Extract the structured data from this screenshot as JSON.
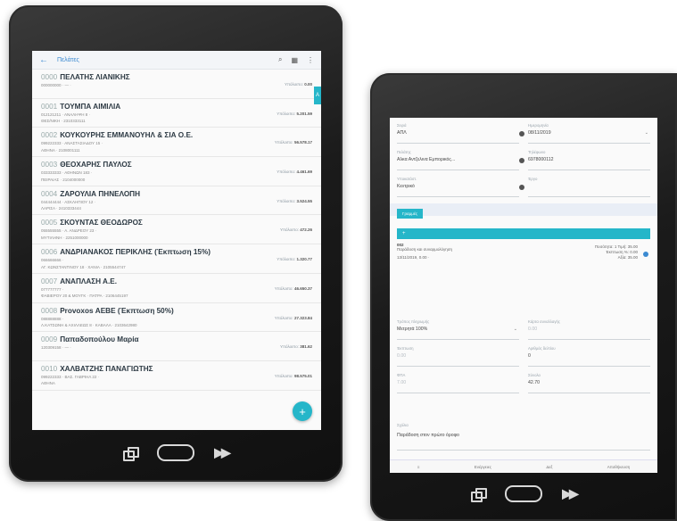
{
  "list_screen": {
    "title": "Πελάτες",
    "side_tab": "A",
    "fab": "+",
    "rows": [
      {
        "code": "0000",
        "name": "ΠΕΛΑΤΗΣ ΛΙΑΝΙΚΗΣ",
        "sub1": "000000000  ·  —  ·",
        "sub2": "",
        "bal_label": "Υπόλοιπο:",
        "bal": "0.00"
      },
      {
        "code": "0001",
        "name": "ΤΟΥΜΠΑ ΑΙΜΙΛΙΑ",
        "sub1": "012121211  ·  ΑΝΑΛΗΨΗ 8  ·",
        "sub2": "ΘΕΣ/ΝΙΚΗ  ·  2310333111",
        "bal_label": "Υπόλοιπο:",
        "bal": "5.201.59"
      },
      {
        "code": "0002",
        "name": "ΚΟΥΚΟΥΡΗΣ ΕΜΜΑΝΟΥΗΛ & ΣΙΑ Ο.Ε.",
        "sub1": "099222333  ·  ΑΝΑΣΤΑΣΙΑΔΟΥ 15  ·",
        "sub2": "ΑΘΗΝΑ  ·  2108001111",
        "bal_label": "Υπόλοιπο:",
        "bal": "56.578.17"
      },
      {
        "code": "0003",
        "name": "ΘΕΟΧΑΡΗΣ ΠΑΥΛΟΣ",
        "sub1": "033333333  ·  ΑΘΗΝΩΝ 183  ·",
        "sub2": "ΠΕΙΡΑΙΑΣ  ·  2104000000",
        "bal_label": "Υπόλοιπο:",
        "bal": "4.461.69"
      },
      {
        "code": "0004",
        "name": "ΖΑΡΟΥΛΙΑ ΠΗΝΕΛΟΠΗ",
        "sub1": "044444444  ·  ΑΣΚΛΗΠΙΟΥ 12  ·",
        "sub2": "ΛΑΡΙΣΑ  ·  2410333444",
        "bal_label": "Υπόλοιπο:",
        "bal": "3.524.55"
      },
      {
        "code": "0005",
        "name": "ΣΚΟΥΝΤΑΣ ΘΕΟΔΩΡΟΣ",
        "sub1": "055555555  ·  Α. ΑΝΔΡΕΟΥ 23  ·",
        "sub2": "ΜΥΤΙΛΗΝΗ  ·  2251000000",
        "bal_label": "Υπόλοιπο:",
        "bal": "472.26"
      },
      {
        "code": "0006",
        "name": "ΑΝΔΡΙΑΝΑΚΟΣ ΠΕΡΙΚΛΗΣ (Έκπτωση 15%)",
        "sub1": "066666666  ·",
        "sub2": "ΑΓ. ΚΩΝΣΤΑΝΤΙΝΟΥ 18  ·  ΧΑΝΙΑ  ·  2105544747",
        "bal_label": "Υπόλοιπο:",
        "bal": "1.320.77"
      },
      {
        "code": "0007",
        "name": "ΑΝΑΠΛΑΣΗ Α.Ε.",
        "sub1": "077777777  ·",
        "sub2": "ΦΑΒΙΕΡΟΥ 20 & ΜΟΥΓΚ  ·  ΠΑΤΡΑ  ·  2106445197",
        "bal_label": "Υπόλοιπο:",
        "bal": "46.650.37"
      },
      {
        "code": "0008",
        "name": "Provoxos ΑΕΒΕ (Έκπτωση 50%)",
        "sub1": "088888888  ·",
        "sub2": "Λ.ΚΑΤΣΩΝΗ & ΑΧΙΛΛΕΩΣ 8  ·  ΚΑΒΑΛΑ  ·  2103642980",
        "bal_label": "Υπόλοιπο:",
        "bal": "27.323.84"
      },
      {
        "code": "0009",
        "name": "Παπαδοπούλου Μαρία",
        "sub1": "120309158  ·  —  ·",
        "sub2": "",
        "bal_label": "Υπόλοιπο:",
        "bal": "381.62"
      },
      {
        "code": "0010",
        "name": "ΧΑΛΒΑΤΖΗΣ ΠΑΝΑΓΙΩΤΗΣ",
        "sub1": "099222333  ·  ΒΑΣ. ΓΑΒΡΙΗΛ 22  ·",
        "sub2": "ΑΘΗΝΑ",
        "bal_label": "Υπόλοιπο:",
        "bal": "98.575.01"
      }
    ]
  },
  "form_screen": {
    "row1": {
      "l_label": "Σειρά",
      "l_val": "ΑΠΛ",
      "r_label": "Ημερομηνία",
      "r_val": "08/11/2019"
    },
    "row2": {
      "l_label": "Πελάτης",
      "l_val": "Αλκα Αντζελινα Εμπορικός...",
      "r_label": "Τηλέφωνο",
      "r_val": "6978000112"
    },
    "row3": {
      "l_label": "Υποκατάστ.",
      "l_val": "Κεντρικό",
      "r_label": "Έργο",
      "r_val": ""
    },
    "tab_label": "Γραμμές",
    "teal_bar": "+",
    "item": {
      "line1": "002",
      "line2": "Παράδοση και συναρμολόγηση",
      "line3": "13/11/2019, 0.00  ·",
      "qty": "Ποσότητα: 1    Τιμή: 35.00",
      "disc": "Έκπτωση %: 0.00",
      "value": "Αξία: 35.00"
    },
    "row4": {
      "l_label": "Τρόπος πληρωμής",
      "l_val": "Μετρητά 100%",
      "r_label": "Κάρτα συναλλαγής",
      "r_val": "0.00"
    },
    "row5": {
      "l_label": "Έκπτωση",
      "l_val": "0.00",
      "r_label": "Αριθμός δελτίου",
      "r_val": "0"
    },
    "row6": {
      "l_label": "ΦΠΑ",
      "l_val": "7.00",
      "r_label": "Σύνολο",
      "r_val": "42.70"
    },
    "notes": {
      "label": "Σχόλια",
      "value": "Παράδοση στον πρώτο όροφο"
    },
    "botnav": {
      "left": "≡",
      "mid": "Ενέργειες",
      "mid2": "Δεξ",
      "right": "Αποθήκευση"
    }
  }
}
